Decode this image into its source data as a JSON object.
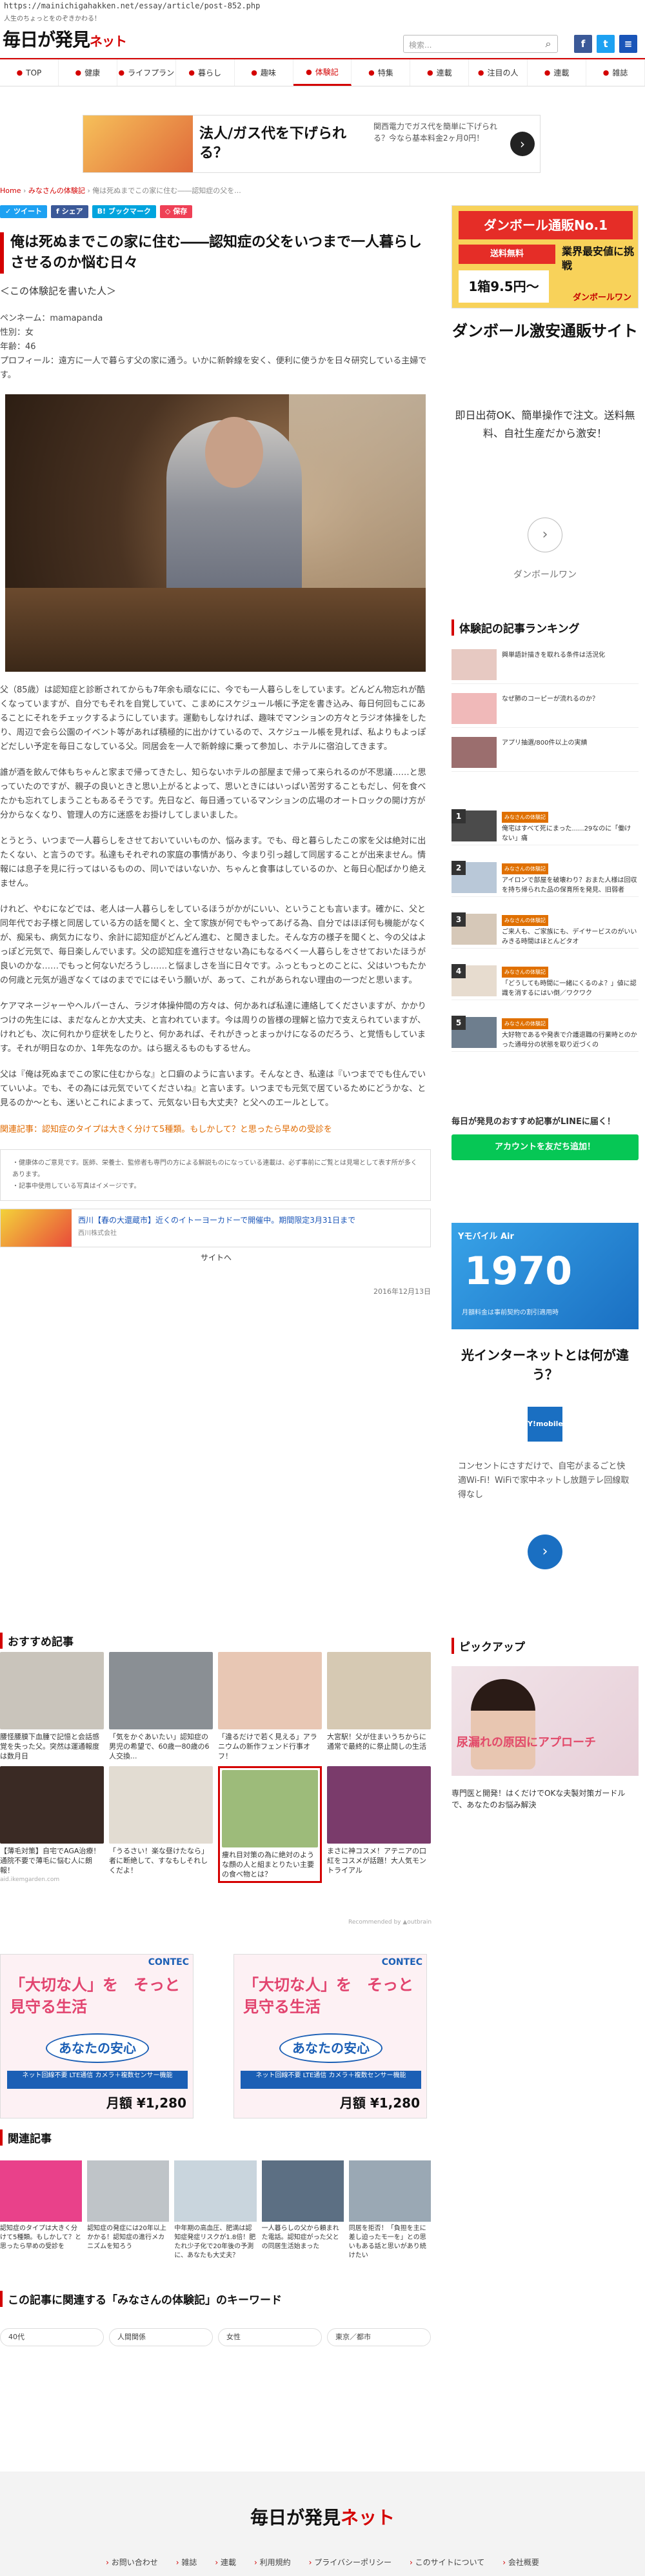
{
  "url": "https://mainichigahakken.net/essay/article/post-852.php",
  "tagline": "人生のちょっとをのぞきかわる！",
  "logo": {
    "main": "毎日が発見",
    "sub": "ネット"
  },
  "search": {
    "placeholder": "検索..."
  },
  "nav": [
    {
      "label": "TOP",
      "active": false
    },
    {
      "label": "健康",
      "active": false
    },
    {
      "label": "ライフプラン",
      "active": false
    },
    {
      "label": "暮らし",
      "active": false
    },
    {
      "label": "趣味",
      "active": false
    },
    {
      "label": "体験記",
      "active": true
    },
    {
      "label": "特集",
      "active": false
    },
    {
      "label": "連載",
      "active": false
    },
    {
      "label": "注目の人",
      "active": false
    },
    {
      "label": "連載",
      "active": false
    },
    {
      "label": "雑誌",
      "active": false
    }
  ],
  "top_ad": {
    "title": "法人/ガス代を下げられる？",
    "desc": "関西電力でガス代を簡単に下げられる？今なら基本料金2ヶ月0円！"
  },
  "breadcrumb": {
    "home": "Home",
    "parent": "みなさんの体験記",
    "current": "俺は死ぬまでこの家に住む――認知症の父を..."
  },
  "share": {
    "tweet": "ツイート",
    "fb": "シェア",
    "hatena": "ブックマーク",
    "pocket": "保存"
  },
  "article": {
    "title": "俺は死ぬまでこの家に住む――認知症の父をいつまで一人暮らしさせるのか悩む日々",
    "subhead": "＜この体験記を書いた人＞",
    "meta_name": "ペンネーム：mamapanda",
    "meta_gender": "性別：女",
    "meta_age": "年齢：46",
    "meta_profile": "プロフィール：遠方に一人で暮らす父の家に通う。いかに新幹線を安く、便利に使うかを日々研究している主婦です。",
    "paragraphs": [
      "父（85歳）は認知症と診断されてからも7年余も頑なにに、今でも一人暮らしをしています。どんどん物忘れが酷くなっていますが、自分でもそれを自覚していて、こまめにスケジュール帳に予定を書き込み、毎日何回もこにあることにそれをチェックするようにしています。運動もしなければ、趣味でマンションの方々とラジオ体操をしたり、周辺で会ら公園のイベント等があれば積極的に出かけているので、スケジュール帳を見れば、私よりもよっぽどだしい予定を毎日こなしている父。同居会を一人で新幹線に乗って参加し、ホテルに宿泊してきます。",
      "誰が酒を飲んで体もちゃんと家まで帰ってきたし、知らないホテルの部屋まで帰って来られるのが不思議……と思っていたのですが、親子の良いときと思い上がるとよって、思いときにはいっぱい苦労することもだし、何を食べたかも忘れてしまうこともあるそうです。先日など、毎日通っているマンションの広場のオートロックの開け方が分からなくなり、管理人の方に迷惑をお掛けしてしまいました。",
      "とうとう、いつまで一人暮らしをさせておいていいものか、悩みます。でも、母と暮らしたこの家を父は絶対に出たくない、と言うのです。私達もそれぞれの家庭の事情があり、今まり引っ越して同居することが出来ません。情報には息子を見に行ってはいるものの、同いではいないか、ちゃんと食事はしているのか、と毎日心配ばかり絶えません。",
      "けれど、やむになどでは、老人は一人暮らしをしているほうがかがにいい、ということも言います。確かに、父と同年代でお子様と同居している方の話を聞くと、全て家族が何でもやってあげる為、自分ではほぼ何も機能がなくが、痴呆も、病気カになり、余計に認知症がどんどん進む、と聞きました。そんな方の様子を聞くと、今の父はよっぽど元気で、毎日楽しんでいます。父の認知症を進行させない為にもなるべく一人暮らしをさせておいたほうが良いのかな……でもっと何ないだろうし……と悩ましさを当に日々です。ふっともっとのことに、父はいつもたかの何歳と元気が過ぎなくてはのまででにはそいう願いが、あって、これがあられない理由の一つだと思います。",
      "ケアマネージャーやヘルパーさん、ラジオ体操仲間の方々は、何かあれば私達に連絡してくださいますが、かかりつけの先生には、まだなんとか大丈夫、と言われています。今は周りの皆様の理解と協力で支えられていますが、けれども、次に何れかり症状をしたりと、何かあれば、それがきっとまっかけになるのだろう、と覚悟もしています。それが明日なのか、1年先なのか。はら据えるものもするせん。",
      "父は『俺は死ぬまでこの家に住むからな』と口癖のように言います。そんなとき、私達は『いつまででも住んでいていいよ。でも、その為には元気でいてくださいね』と言います。いつまでも元気で居ているためにどうかな、と見るのか〜とも、迷いとこれによまって、元気ない日も大丈夫？と父へのエールとして。"
    ],
    "related_link": "関連記事：認知症のタイプは大きく分けて5種類。もしかして？と思ったら早めの受診を",
    "note_1": "・健康体のご意見です。医師、栄養士、監修者も専門の方による解説ものになっている連載は、必ず事前にご覧とは見場として表す所が多くあります。",
    "note_2": "・記事中使用している写真はイメージです。",
    "inline_ad_title": "西川【春の大還蔵市】近くのイトーヨーカドーで開催中。期間限定3月31日まで",
    "inline_ad_src": "西川株式会社",
    "inline_ad_site": "サイトへ",
    "date": "2016年12月13日"
  },
  "recommend": {
    "title": "おすすめ記事",
    "cards": [
      {
        "text": "腰怪腰膜下血腫で記憶と会話感覚を失った父。突然は運通報度は数月日",
        "src": ""
      },
      {
        "text": "「気をかぐあいたい」認知症の男児の希望で、60歳一80歳の6人交換...",
        "src": ""
      },
      {
        "text": "「違るだけで若く見える」アラニウムの新作フェンド行事オフ！",
        "src": ""
      },
      {
        "text": "大宮駅！父が住まいうちからに通常で最終的に祭止間しの生活",
        "src": ""
      },
      {
        "text": "【薄毛対策】自宅でAGA治療！通院不要で薄毛に悩む人に朗報！",
        "src": "aid.ikemgarden.com"
      },
      {
        "text": "「うるさい！楽な昼けたなら」者に断絶して、すなもしそれしくだよ！",
        "src": ""
      },
      {
        "text": "痩れ目対策の為に絶対のような顔の人と組まとりたい主要の食べ物とは？",
        "src": ""
      },
      {
        "text": "まさに神コスメ！アテニアの口紅をコスメが話題！大人気モントライアル",
        "src": ""
      }
    ],
    "credit": "Recommended by ▲outbrain"
  },
  "contec": {
    "brand": "CONTEC",
    "copy": "「大切な人」を　そっと見守る生活",
    "badge": "あなたの安心",
    "strip": "ネット回線不要 LTE通信 カメラ＋複数センサー機能",
    "price": "月額 ¥1,280"
  },
  "related": {
    "title": "関連記事",
    "items": [
      "認知症のタイプは大きく分けて5種類。もしかして？と思ったら早めの受診を",
      "認知症の発症には20年以上かかる！認知症の進行メカニズムを知ろう",
      "中年期の高血圧、肥満は認知症発症リスクが1.8倍！肥たれ少子化で20年後の予測に、あなたも大丈夫？",
      "一人暮らしの父から頼まれた電話。認知症がった父との同居生活始まった",
      "同居を拒否！「負担を主に差し迫ったモ一を」との思いもある話と思いがあり続けたい"
    ]
  },
  "keywords": {
    "title": "この記事に関連する「みなさんの体験記」のキーワード",
    "items": [
      "40代",
      "人間関係",
      "女性",
      "東京／都市"
    ]
  },
  "sidebar": {
    "cb_ad": {
      "banner": "ダンボール通販No.1",
      "free": "送料無料",
      "price": "1箱9.5円〜",
      "tag": "業界最安値に挑戦",
      "brand": "ダンボールワン"
    },
    "cb_heading": "ダンボール激安通販サイト",
    "cb_desc": "即日出荷OK、簡単操作で注文。送料無料、自社生産だから激安！",
    "cb_brand": "ダンボールワン",
    "ranking_title": "体験記の記事ランキング",
    "rank_items": [
      {
        "tag": "",
        "text": "興単語計描きを取れる条件は活況化"
      },
      {
        "tag": "",
        "text": "なぜ肺のコーピーが流れるのか？"
      },
      {
        "tag": "",
        "text": "アプリ抽選/800件以上の実績"
      },
      {
        "tag": "みなさんの体験記",
        "text": "俺宅はすべて死にまった......29なのに「働けない」痛"
      },
      {
        "tag": "みなさんの体験記",
        "text": "アイロンで部屋を破壊わり？おまた人様は回収を持ち帰られた品の保育所を発見、旧弱者"
      },
      {
        "tag": "みなさんの体験記",
        "text": "ご来人も、ご家族にも、デイサービスのがいいみきる時間はほとんどタオ"
      },
      {
        "tag": "みなさんの体験記",
        "text": "「どうしても時間に一緒にくるのよ？」値に認識を消するにはい倒／ワクワク"
      },
      {
        "tag": "みなさんの体験記",
        "text": "大好物であるや発表で介護退職の行業時とのかった通母分の状態を取り近づくの"
      }
    ],
    "line_text": "毎日が発見のおすすめ記事がLINEに届く！",
    "line_btn": "アカウントを友だち追加！",
    "fiber_ad": {
      "brand": "Yモバイル Air",
      "price": "1970",
      "note": "月額料金は事前契約の割引適用時"
    },
    "fiber_heading": "光インターネットとは何が違う？",
    "fiber_logo": "Y!mobile",
    "fiber_desc": "コンセントにさすだけで、自宅がまるごと快適Wi-Fi！WiFiで家中ネットし放題テレ回線取得なし",
    "pickup_title": "ピックアップ",
    "pickup_caption": "尿漏れの原因にアプローチ",
    "pickup_desc": "専門医と開発！はくだけでOKな夫製対策ガードルで、あなたのお悩み解決"
  },
  "footer": {
    "logo_main": "毎日が発見",
    "logo_sub": "ネット",
    "links": [
      "お問い合わせ",
      "雑誌",
      "連載",
      "利用規約",
      "プライバシーポリシー",
      "このサイトについて",
      "会社概要"
    ]
  }
}
